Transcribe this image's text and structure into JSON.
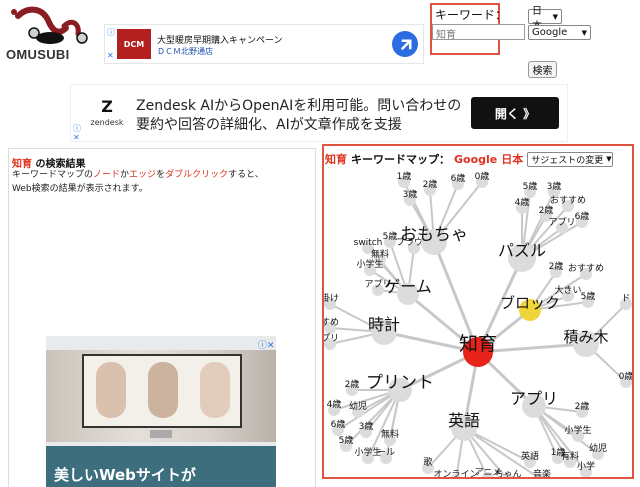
{
  "logo": {
    "text": "OMUSUBI"
  },
  "top_ad": {
    "brand": "DCM",
    "headline": "大型暖房早期購入キャンペーン",
    "store": "ＤＣＭ北野通店",
    "icons": [
      "info-icon",
      "close-icon",
      "directions-icon"
    ]
  },
  "search": {
    "label": "キーワード：",
    "value": "知育",
    "language": "日本",
    "engine": "Google",
    "submit": "検索"
  },
  "zendesk_ad": {
    "logo_text": "zendesk",
    "text_line1": "Zendesk AIからOpenAIを利用可能。問い合わせの",
    "text_line2": "要約や回答の詳細化、AIが文章作成を支援",
    "cta": "開く 》"
  },
  "results": {
    "title_keyword": "知育",
    "title_suffix": " の検索結果",
    "desc_line1": {
      "a": "キーワードマップの",
      "b": "ノード",
      "c": "か",
      "d": "エッジ",
      "e": "を",
      "f": "ダブルクリック",
      "g": "すると、"
    },
    "desc_line2": "Web検索の結果が表示されます。"
  },
  "ad2": {
    "headline": "美しいWebサイトが"
  },
  "map": {
    "keyword": "知育",
    "title": "キーワードマップ：",
    "engine": "Google",
    "lang": "日本",
    "suggest_change": "サジェストの変更",
    "colors": {
      "center": "#e8231a",
      "highlight": "#f0d53a",
      "node": "#dcdcdc",
      "edge": "#c8c8c8"
    },
    "center_label": "知育",
    "hubs": [
      "おもちゃ",
      "パズル",
      "ゲーム",
      "ブロック",
      "時計",
      "積み木",
      "プリント",
      "アプリ",
      "英語"
    ],
    "leaves": [
      "1歳",
      "2歳",
      "6歳",
      "0歳",
      "3歳",
      "5歳",
      "3歳",
      "4歳",
      "おすすめ",
      "2歳",
      "アプリ",
      "6歳",
      "5歳",
      "ブラウザ",
      "switch",
      "無料",
      "小学生",
      "アプリ",
      "2歳",
      "おすすめ",
      "大きい",
      "5歳",
      "掛け",
      "すめ",
      "プリ",
      "2歳",
      "4歳",
      "幼児",
      "6歳",
      "3歳",
      "5歳",
      "無料",
      "小学生",
      "ール",
      "2歳",
      "小学生",
      "1歳",
      "有料",
      "幼児",
      "小学",
      "英語",
      "歌",
      "オンライン",
      "アニメ",
      "ちゃん",
      "音楽",
      "ド",
      "0歳"
    ]
  }
}
